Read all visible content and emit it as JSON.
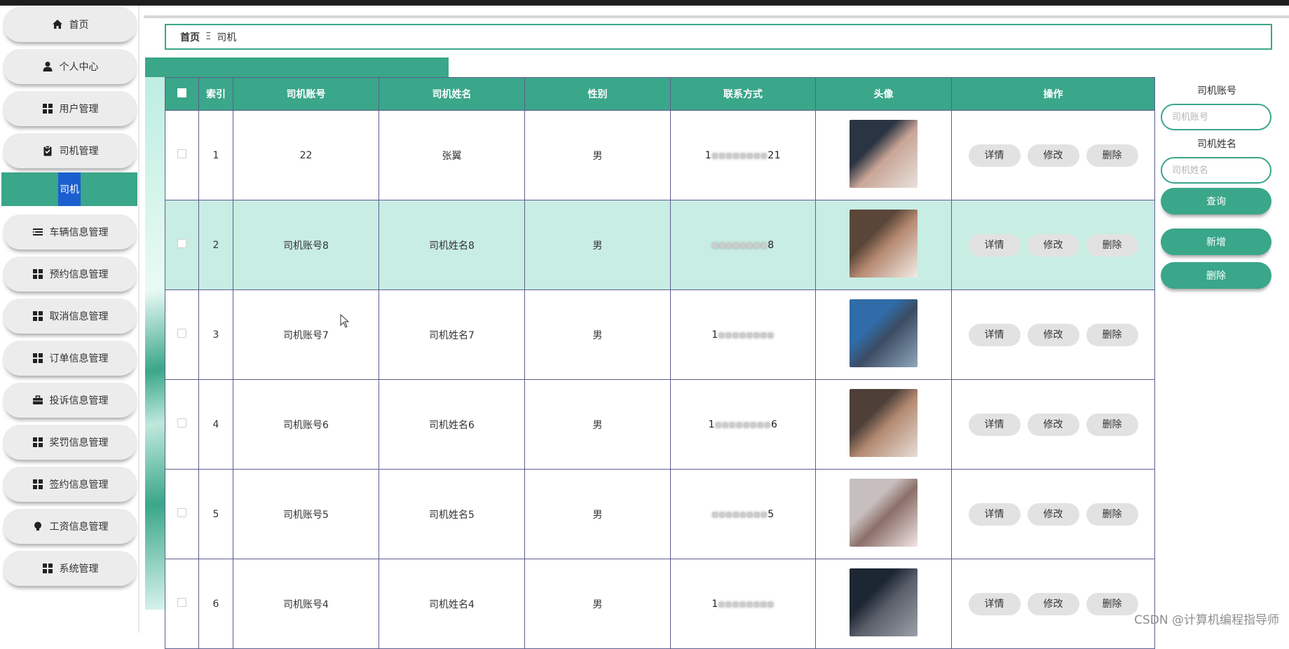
{
  "colors": {
    "accent": "#3aa68a",
    "sub_active": "#1b5fcf",
    "row_highlight": "#c8ede3"
  },
  "sidebar": {
    "items": [
      {
        "label": "首页",
        "icon": "home-icon"
      },
      {
        "label": "个人中心",
        "icon": "user-icon"
      },
      {
        "label": "用户管理",
        "icon": "grid-icon"
      },
      {
        "label": "司机管理",
        "icon": "clipboard-icon"
      },
      {
        "label": "司机",
        "sub": true
      },
      {
        "label": "车辆信息管理",
        "icon": "list-icon"
      },
      {
        "label": "预约信息管理",
        "icon": "grid-icon"
      },
      {
        "label": "取消信息管理",
        "icon": "grid-icon"
      },
      {
        "label": "订单信息管理",
        "icon": "grid-icon"
      },
      {
        "label": "投诉信息管理",
        "icon": "briefcase-icon"
      },
      {
        "label": "奖罚信息管理",
        "icon": "grid-icon"
      },
      {
        "label": "签约信息管理",
        "icon": "grid-icon"
      },
      {
        "label": "工资信息管理",
        "icon": "bulb-icon"
      },
      {
        "label": "系统管理",
        "icon": "grid-icon"
      }
    ]
  },
  "breadcrumb": {
    "home": "首页",
    "separator": "Ξ",
    "current": "司机"
  },
  "table": {
    "columns": [
      "索引",
      "司机账号",
      "司机姓名",
      "性别",
      "联系方式",
      "头像",
      "操作"
    ],
    "rows": [
      {
        "index": "1",
        "account": "22",
        "name": "张翼",
        "gender": "男",
        "phone_a": "1",
        "phone_b": "21",
        "avatar": "photo-1",
        "highlight": false
      },
      {
        "index": "2",
        "account": "司机账号8",
        "name": "司机姓名8",
        "gender": "男",
        "phone_a": "",
        "phone_b": "8",
        "avatar": "photo-2",
        "highlight": true
      },
      {
        "index": "3",
        "account": "司机账号7",
        "name": "司机姓名7",
        "gender": "男",
        "phone_a": "1",
        "phone_b": "",
        "avatar": "photo-3",
        "highlight": false
      },
      {
        "index": "4",
        "account": "司机账号6",
        "name": "司机姓名6",
        "gender": "男",
        "phone_a": "1",
        "phone_b": "6",
        "avatar": "photo-4",
        "highlight": false
      },
      {
        "index": "5",
        "account": "司机账号5",
        "name": "司机姓名5",
        "gender": "男",
        "phone_a": "",
        "phone_b": "5",
        "avatar": "photo-5",
        "highlight": false
      },
      {
        "index": "6",
        "account": "司机账号4",
        "name": "司机姓名4",
        "gender": "男",
        "phone_a": "1",
        "phone_b": "",
        "avatar": "photo-6",
        "highlight": false
      }
    ],
    "actions": {
      "detail": "详情",
      "edit": "修改",
      "delete": "删除"
    }
  },
  "search": {
    "account_label": "司机账号",
    "account_placeholder": "司机账号",
    "name_label": "司机姓名",
    "name_placeholder": "司机姓名",
    "query_button": "查询",
    "add_button": "新增",
    "delete_button": "删除"
  },
  "watermark": "CSDN @计算机编程指导师"
}
